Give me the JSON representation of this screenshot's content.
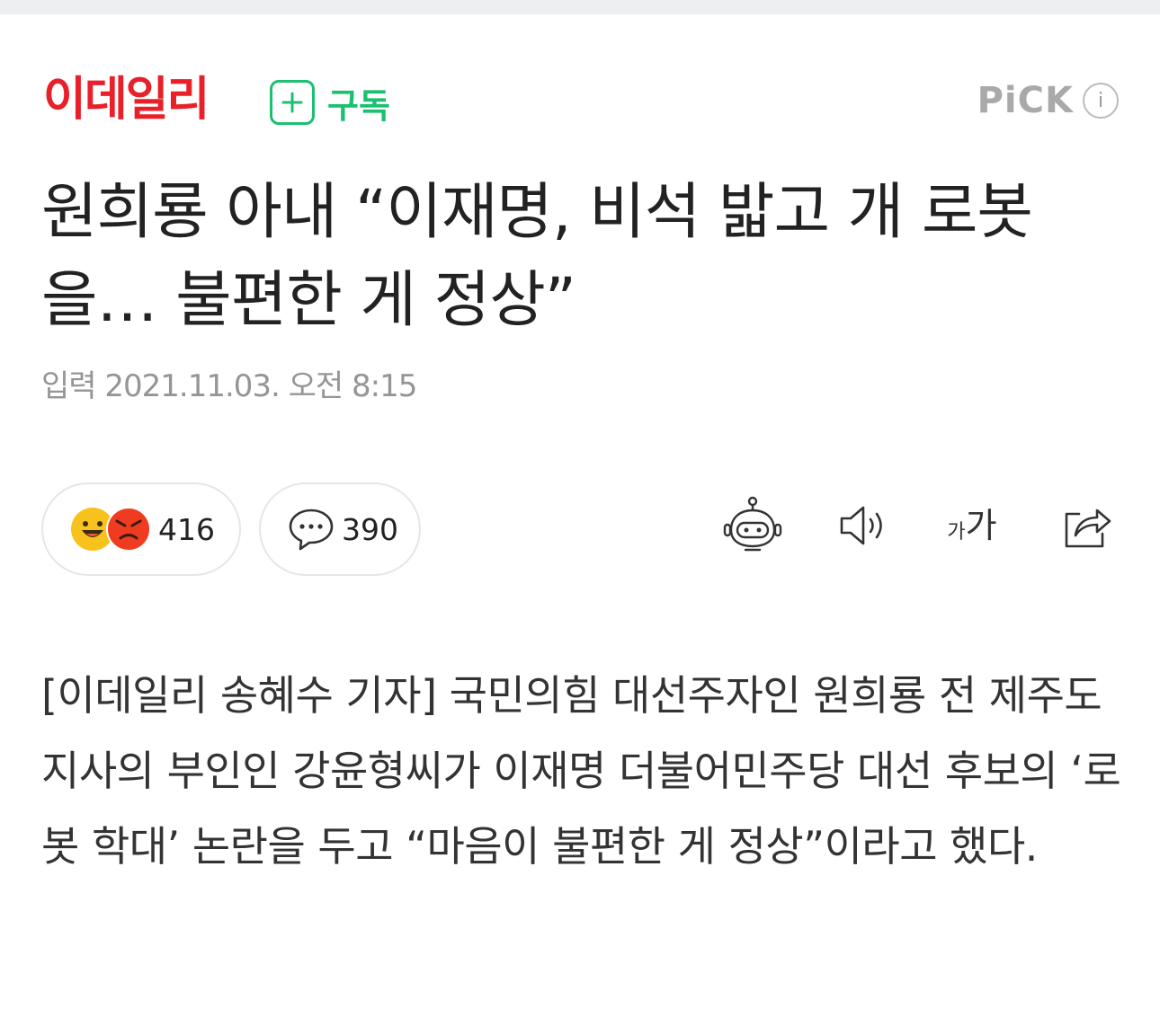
{
  "header": {
    "logo_text": "이데일리",
    "subscribe_label": "구독",
    "pick_label": "PiCK",
    "pick_info_label": "i"
  },
  "article": {
    "headline": "원희룡 아내 “이재명, 비석 밟고 개 로봇을… 불편한 게 정상”",
    "date": "입력 2021.11.03. 오전 8:15",
    "body": "[이데일리 송혜수 기자] 국민의힘 대선주자인 원희룡 전 제주도지사의 부인인 강윤형씨가 이재명 더불어민주당 대선 후보의 ‘로봇 학대’ 논란을 두고 “마음이 불편한 게 정상”이라고 했다."
  },
  "actions": {
    "reaction_count": "416",
    "comment_count": "390",
    "font_size_small": "가",
    "font_size_large": "가"
  },
  "icons": {
    "subscribe": "plus-icon",
    "reactions": [
      "smile-emoji-icon",
      "angry-emoji-icon"
    ],
    "comment": "comment-bubble-icon",
    "summary": "robot-icon",
    "tts": "speaker-icon",
    "font": "font-size-icon",
    "share": "share-icon"
  },
  "colors": {
    "brand_red": "#e8202a",
    "subscribe_green": "#1dbf70",
    "pick_gray": "#a9a9a9",
    "date_gray": "#959595",
    "smile_yellow": "#f8c21d",
    "angry_red": "#ef3b1f"
  }
}
